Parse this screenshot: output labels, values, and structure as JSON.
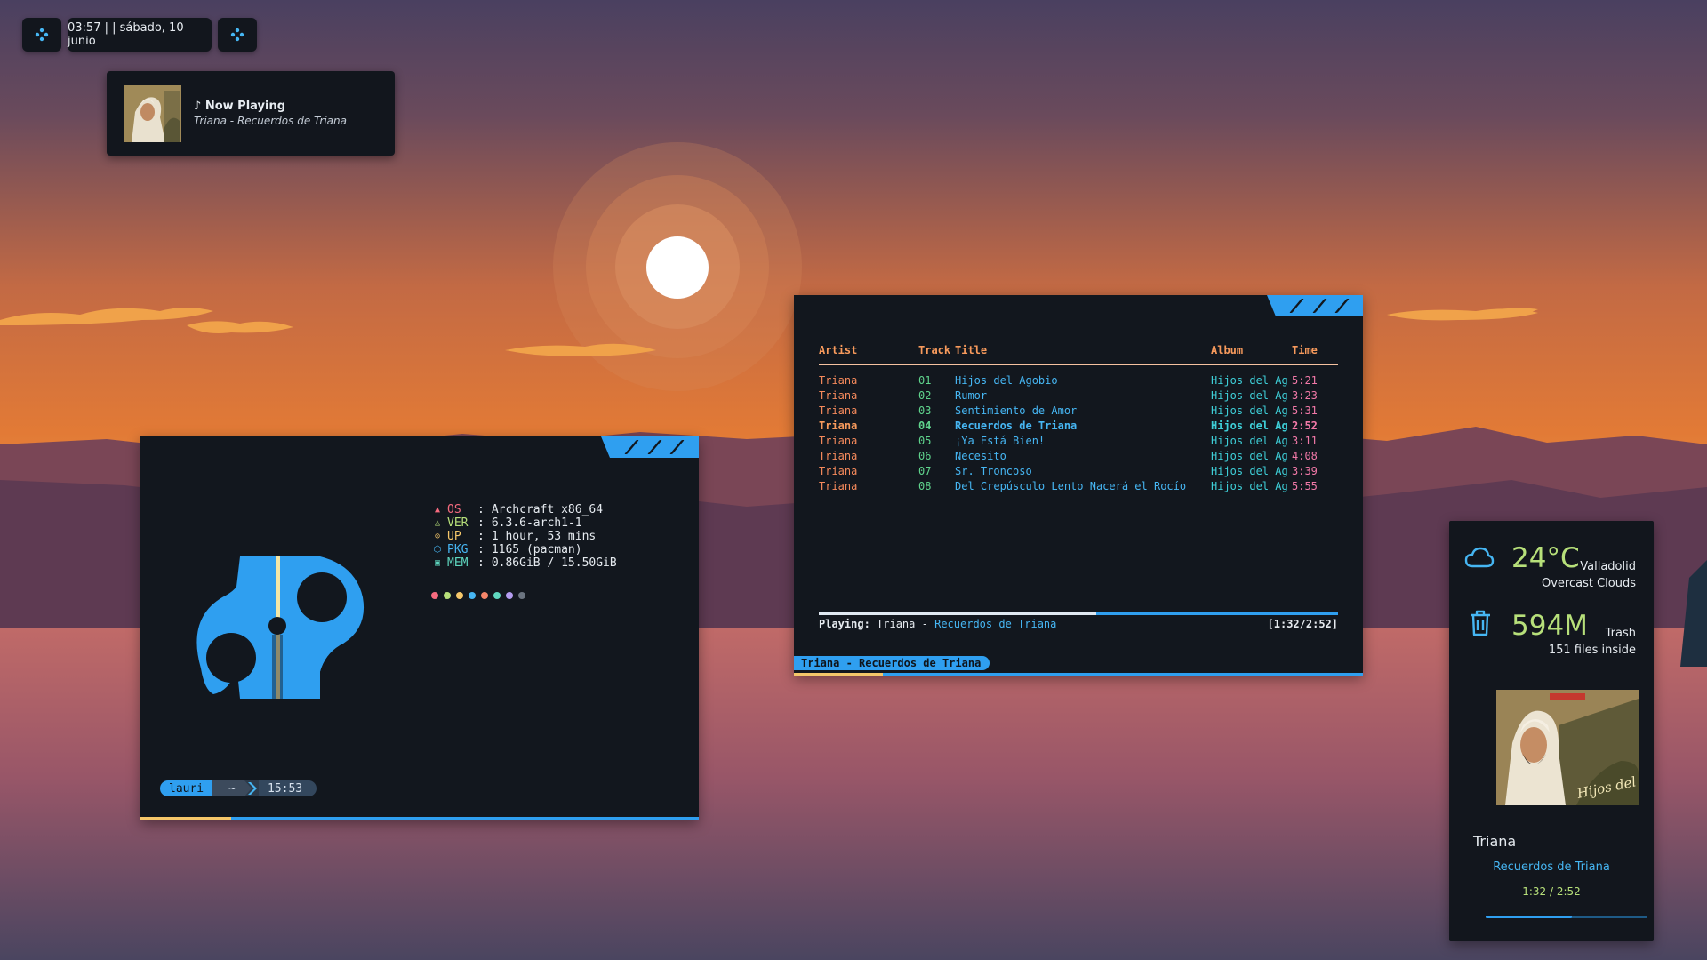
{
  "topbar": {
    "left_icon": "workspace-icon",
    "clock_text": "03:57 | | sábado, 10 junio",
    "right_icon": "workspace-icon"
  },
  "now_playing": {
    "heading": "♪ Now Playing",
    "subtitle": "Triana - Recuerdos de Triana"
  },
  "neofetch": {
    "info": [
      {
        "icon": "▲",
        "key": "OS",
        "value": "Archcraft x86_64",
        "color": "#f76b7f"
      },
      {
        "icon": "△",
        "key": "VER",
        "value": "6.3.6-arch1-1",
        "color": "#b7e07a"
      },
      {
        "icon": "⊙",
        "key": "UP",
        "value": "1 hour, 53 mins",
        "color": "#f5c76a"
      },
      {
        "icon": "⬡",
        "key": "PKG",
        "value": "1165 (pacman)",
        "color": "#46b6f3"
      },
      {
        "icon": "▣",
        "key": "MEM",
        "value": "0.86GiB / 15.50GiB",
        "color": "#5fd8c0"
      }
    ],
    "palette": [
      "#f76b7f",
      "#b7e07a",
      "#f5c76a",
      "#46b6f3",
      "#f6866a",
      "#5fd8c0",
      "#b49cf0",
      "#6b7480"
    ],
    "prompt": {
      "user": "lauri",
      "dir": "~",
      "time": "15:53"
    }
  },
  "ncmpcpp": {
    "headers": {
      "artist": "Artist",
      "track": "Track",
      "title": "Title",
      "album": "Album",
      "time": "Time"
    },
    "tracks": [
      {
        "artist": "Triana",
        "num": "01",
        "title": "Hijos del Agobio",
        "album": "Hijos del Ag",
        "time": "5:21",
        "current": false
      },
      {
        "artist": "Triana",
        "num": "02",
        "title": "Rumor",
        "album": "Hijos del Ag",
        "time": "3:23",
        "current": false
      },
      {
        "artist": "Triana",
        "num": "03",
        "title": "Sentimiento de Amor",
        "album": "Hijos del Ag",
        "time": "5:31",
        "current": false
      },
      {
        "artist": "Triana",
        "num": "04",
        "title": "Recuerdos de Triana",
        "album": "Hijos del Ag",
        "time": "2:52",
        "current": true
      },
      {
        "artist": "Triana",
        "num": "05",
        "title": "¡Ya Está Bien!",
        "album": "Hijos del Ag",
        "time": "3:11",
        "current": false
      },
      {
        "artist": "Triana",
        "num": "06",
        "title": "Necesito",
        "album": "Hijos del Ag",
        "time": "4:08",
        "current": false
      },
      {
        "artist": "Triana",
        "num": "07",
        "title": "Sr. Troncoso",
        "album": "Hijos del Ag",
        "time": "3:39",
        "current": false
      },
      {
        "artist": "Triana",
        "num": "08",
        "title": "Del Crepúsculo Lento Nacerá el Rocío",
        "album": "Hijos del Ag",
        "time": "5:55",
        "current": false
      }
    ],
    "status_label": "Playing:",
    "status_artist": "Triana",
    "status_dash": "-",
    "status_title": "Recuerdos de Triana",
    "position": "[1:32/2:52]",
    "progress": 0.535,
    "tmux_label": "Triana - Recuerdos de Triana"
  },
  "widget": {
    "weather": {
      "temp": "24°C",
      "city": "Valladolid",
      "desc": "Overcast Clouds",
      "icon": "cloud-icon"
    },
    "trash": {
      "size": "594M",
      "label": "Trash",
      "count": "151 files inside",
      "icon": "trash-icon"
    },
    "music": {
      "artist": "Triana",
      "title": "Recuerdos de Triana",
      "time": "1:32 / 2:52",
      "progress": 0.535
    }
  }
}
